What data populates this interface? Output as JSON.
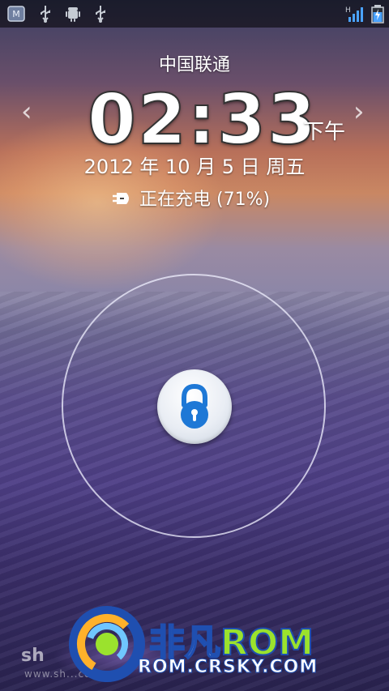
{
  "status_bar": {
    "left_icons": [
      "app-notification-icon",
      "usb-icon",
      "android-debug-icon",
      "usb-icon"
    ],
    "right_icons": [
      "signal-h-icon",
      "battery-charging-icon"
    ],
    "network_type": "H"
  },
  "lockscreen": {
    "carrier": "中国联通",
    "time": "02:33",
    "ampm": "下午",
    "date": "2012 年 10 月 5 日 周五",
    "charging_text": "正在充电 (71%)",
    "battery_level_percent": 71,
    "nav_left": "‹",
    "nav_right": "›"
  },
  "watermark": {
    "brand_left": "sh",
    "brand_sub": "www.sh...com",
    "title_a": "非凡",
    "title_b": "ROM",
    "url": "ROM.CRSKY.COM"
  },
  "colors": {
    "lock_blue": "#1e78d6",
    "ring": "#f0f0ff",
    "watermark_green": "#9be22d",
    "watermark_blue": "#1f4fb0"
  }
}
